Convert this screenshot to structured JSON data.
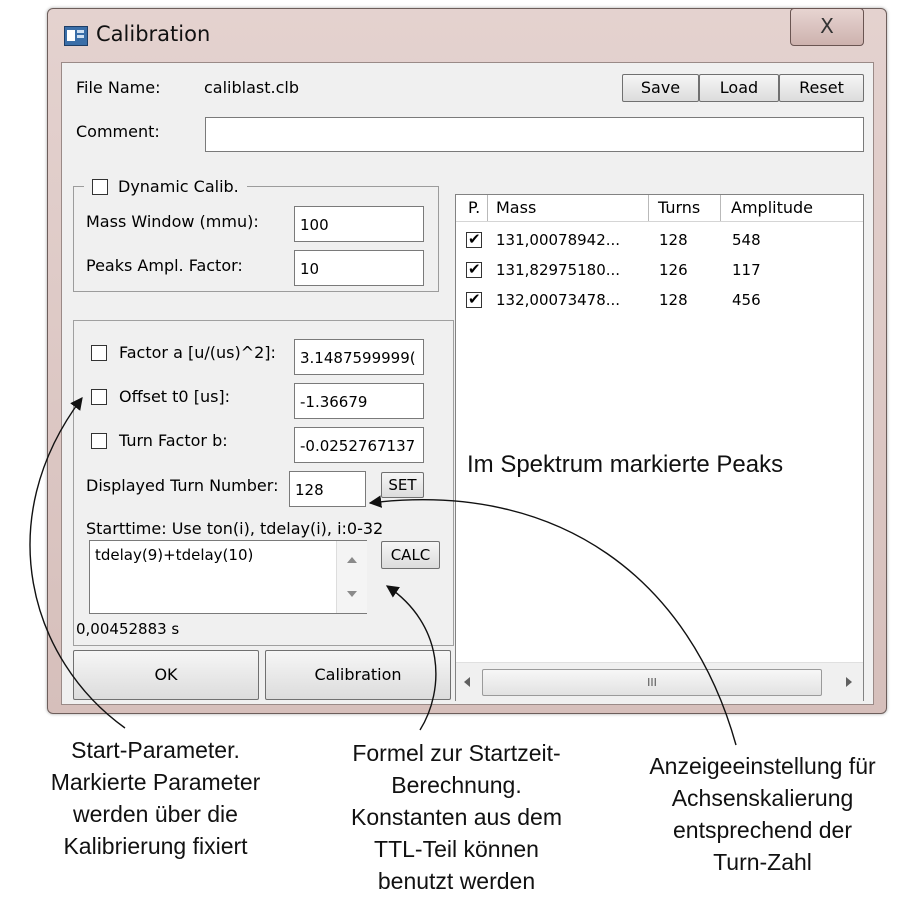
{
  "window": {
    "title": "Calibration",
    "close_glyph": "X"
  },
  "file": {
    "label": "File Name:",
    "value": "caliblast.clb"
  },
  "buttons": {
    "save": "Save",
    "load": "Load",
    "reset": "Reset",
    "ok": "OK",
    "calibration": "Calibration",
    "set": "SET",
    "calc": "CALC"
  },
  "comment": {
    "label": "Comment:",
    "value": ""
  },
  "dynamic": {
    "label": "Dynamic Calib.",
    "checked": false,
    "mass_window_label": "Mass Window (mmu):",
    "mass_window_value": "100",
    "peaks_ampl_label": "Peaks Ampl. Factor:",
    "peaks_ampl_value": "10"
  },
  "params": {
    "factor_a_label": "Factor a [u/(us)^2]:",
    "factor_a_value": "3.1487599999(",
    "offset_label": "Offset t0 [us]:",
    "offset_value": "-1.36679",
    "turn_factor_label": "Turn Factor b:",
    "turn_factor_value": "-0.0252767137",
    "turn_number_label": "Displayed Turn Number:",
    "turn_number_value": "128",
    "starttime_label": "Starttime: Use ton(i), tdelay(i), i:0-32",
    "formula": "tdelay(9)+tdelay(10)",
    "result": "0,00452883 s"
  },
  "table": {
    "headers": [
      "P.",
      "Mass",
      "Turns",
      "Amplitude"
    ],
    "rows": [
      {
        "checked": true,
        "mass": "131,00078942...",
        "turns": "128",
        "amplitude": "548"
      },
      {
        "checked": true,
        "mass": "131,82975180...",
        "turns": "126",
        "amplitude": "117"
      },
      {
        "checked": true,
        "mass": "132,00073478...",
        "turns": "128",
        "amplitude": "456"
      }
    ],
    "scroll_thumb_glyph": "III"
  },
  "annotations": {
    "peaks": "Im Spektrum markierte Peaks",
    "start_params": [
      "Start-Parameter.",
      "Markierte Parameter",
      "werden über die",
      "Kalibrierung fixiert"
    ],
    "formula": [
      "Formel zur Startzeit-",
      "Berechnung.",
      "Konstanten aus dem",
      "TTL-Teil können",
      "benutzt werden"
    ],
    "display": [
      "Anzeigeeinstellung für",
      "Achsenskalierung",
      "entsprechend der",
      "Turn-Zahl"
    ]
  }
}
